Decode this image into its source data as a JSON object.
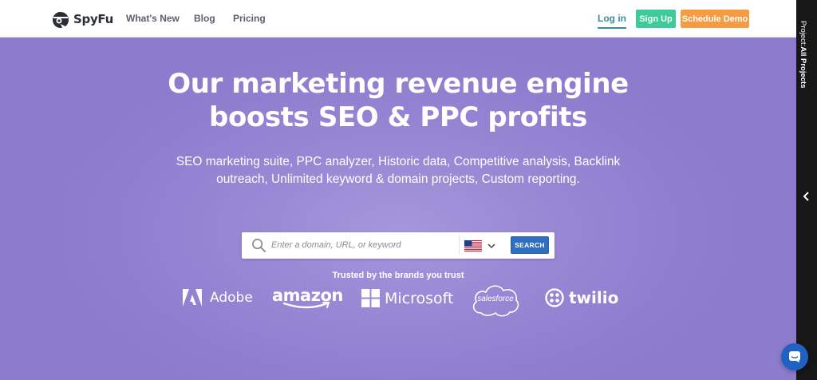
{
  "header": {
    "logo_text": "SpyFu",
    "nav": [
      {
        "label": "What's New"
      },
      {
        "label": "Blog"
      },
      {
        "label": "Pricing"
      }
    ],
    "login_label": "Log in",
    "signup_label": "Sign Up",
    "demo_label": "Schedule Demo",
    "colors": {
      "signup": "#3ccc98",
      "demo": "#f59c43",
      "login": "#3b8d98"
    }
  },
  "hero": {
    "headline_line1": "Our marketing revenue engine",
    "headline_line2": "boosts SEO & PPC profits",
    "subhead": "SEO marketing suite, PPC analyzer, Historic data, Competitive analysis, Backlink outreach, Unlimited keyword & domain projects, Custom reporting.",
    "background_color": "#8f7ed0"
  },
  "search": {
    "placeholder": "Enter a domain, URL, or keyword",
    "value": "",
    "country": "us-flag-icon",
    "button_label": "SEARCH",
    "button_color": "#2f6fbf"
  },
  "trusted": {
    "title": "Trusted by the brands you trust",
    "brands": [
      {
        "name": "Adobe"
      },
      {
        "name": "amazon"
      },
      {
        "name": "Microsoft"
      },
      {
        "name": "salesforce"
      },
      {
        "name": "twilio"
      }
    ]
  },
  "side_panel": {
    "label_prefix": "Project:",
    "label_value": "All Projects"
  }
}
